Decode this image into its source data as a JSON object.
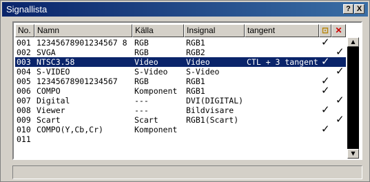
{
  "window": {
    "title": "Signallista",
    "help_label": "?",
    "close_label": "X"
  },
  "columns": {
    "no": "No.",
    "name": "Namn",
    "source": "Källa",
    "input": "Insignal",
    "tangent": "tangent",
    "lock_icon": "lock-icon",
    "skip_icon": "skip-icon"
  },
  "rows": [
    {
      "no": "001",
      "name": "12345678901234567 8",
      "source": "RGB",
      "input": "RGB1",
      "tangent": "",
      "lock": true,
      "skip": false,
      "selected": false
    },
    {
      "no": "002",
      "name": "SVGA",
      "source": "RGB",
      "input": "RGB2",
      "tangent": "",
      "lock": false,
      "skip": true,
      "selected": false
    },
    {
      "no": "003",
      "name": "NTSC3.58",
      "source": "Video",
      "input": "Video",
      "tangent": "CTL + 3 tangent",
      "lock": true,
      "skip": false,
      "selected": true
    },
    {
      "no": "004",
      "name": "S-VIDEO",
      "source": "S-Video",
      "input": "S-Video",
      "tangent": "",
      "lock": false,
      "skip": true,
      "selected": false
    },
    {
      "no": "005",
      "name": "12345678901234567",
      "source": "RGB",
      "input": "RGB1",
      "tangent": "",
      "lock": true,
      "skip": false,
      "selected": false
    },
    {
      "no": "006",
      "name": "COMPO",
      "source": "Komponent",
      "input": "RGB1",
      "tangent": "",
      "lock": true,
      "skip": false,
      "selected": false
    },
    {
      "no": "007",
      "name": "Digital",
      "source": "---",
      "input": "DVI(DIGITAL)",
      "tangent": "",
      "lock": false,
      "skip": true,
      "selected": false
    },
    {
      "no": "008",
      "name": "Viewer",
      "source": "---",
      "input": "Bildvisare",
      "tangent": "",
      "lock": true,
      "skip": false,
      "selected": false
    },
    {
      "no": "009",
      "name": "Scart",
      "source": "Scart",
      "input": "RGB1(Scart)",
      "tangent": "",
      "lock": false,
      "skip": true,
      "selected": false
    },
    {
      "no": "010",
      "name": "COMPO(Y,Cb,Cr)",
      "source": "Komponent",
      "input": "",
      "tangent": "",
      "lock": true,
      "skip": false,
      "selected": false
    },
    {
      "no": "011",
      "name": "",
      "source": "",
      "input": "",
      "tangent": "",
      "lock": false,
      "skip": false,
      "selected": false
    }
  ],
  "check_glyph": "✓",
  "scrollbar": {
    "up_label": "▲",
    "down_label": "▼"
  },
  "status_text": ""
}
